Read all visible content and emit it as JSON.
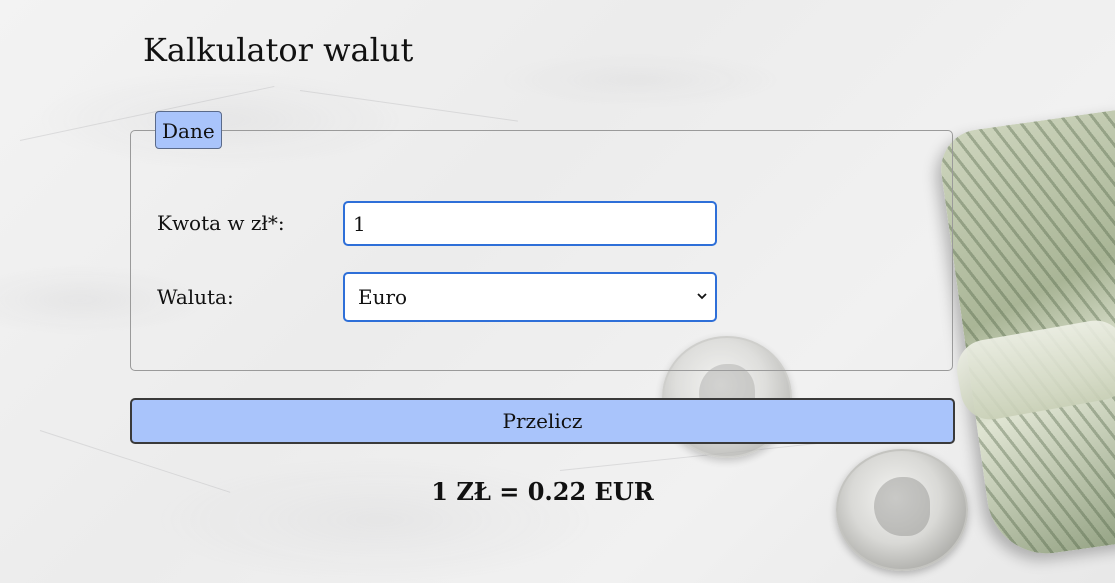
{
  "page": {
    "title": "Kalkulator walut"
  },
  "form": {
    "legend": "Dane",
    "amount_label": "Kwota w zł*:",
    "amount_value": "1",
    "currency_label": "Waluta:",
    "currency_selected": "Euro",
    "convert_label": "Przelicz"
  },
  "result": {
    "text": "1 ZŁ = 0.22 EUR"
  },
  "colors": {
    "accent": "#a9c4fb",
    "input_border": "#2e6fd8"
  }
}
